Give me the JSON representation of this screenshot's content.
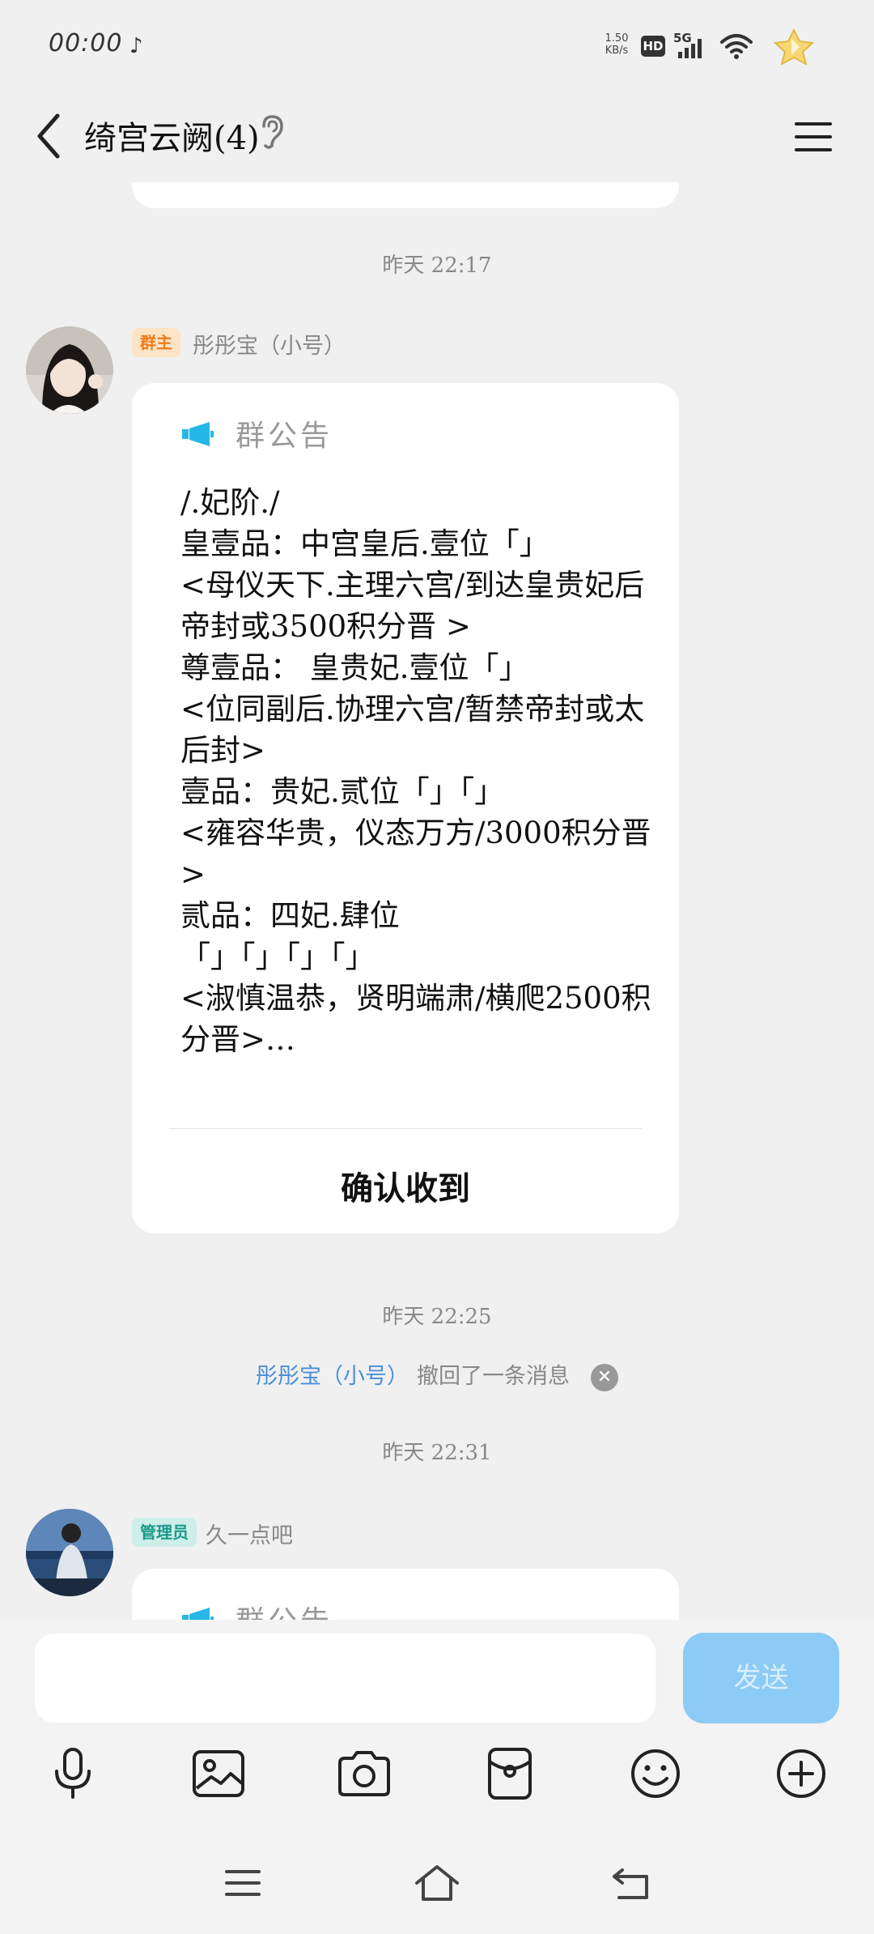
{
  "status_bar": {
    "time": "00:00",
    "net_speed_value": "1.50",
    "net_speed_unit": "KB/s",
    "hd": "HD",
    "network": "5G"
  },
  "header": {
    "title": "绮宫云阙(4)"
  },
  "messages": {
    "top_partial_text": "",
    "ts1": "昨天 22:17",
    "msg1": {
      "role_badge": "群主",
      "sender": "彤彤宝（小号）",
      "announce_title": "群公告",
      "body": "/.妃阶./\n皇壹品：中宫皇后.壹位「」\n<母仪天下.主理六宫/到达皇贵妃后帝封或3500积分晋 >\n尊壹品： 皇贵妃.壹位「」\n<位同副后.协理六宫/暂禁帝封或太后封>\n壹品：贵妃.贰位「」「」\n<雍容华贵，仪态万方/3000积分晋>\n贰品：四妃.肆位\n「」「」「」「」\n<淑慎温恭，贤明端肃/横爬2500积分晋>…",
      "confirm": "确认收到"
    },
    "ts2": "昨天 22:25",
    "recall": {
      "name": "彤彤宝（小号）",
      "text": "撤回了一条消息"
    },
    "ts3": "昨天 22:31",
    "msg2": {
      "role_badge": "管理员",
      "sender": "久一点吧",
      "announce_title": "群公告"
    }
  },
  "input": {
    "placeholder": "",
    "send_label": "发送"
  },
  "colors": {
    "owner_badge_bg": "#fde4c6",
    "owner_badge_text": "#f07a1a",
    "admin_badge_bg": "#cdeee9",
    "admin_badge_text": "#1a9a8a",
    "send_button": "#8ccbf5",
    "recall_name": "#4a8fd8",
    "megaphone": "#25b8e6"
  }
}
